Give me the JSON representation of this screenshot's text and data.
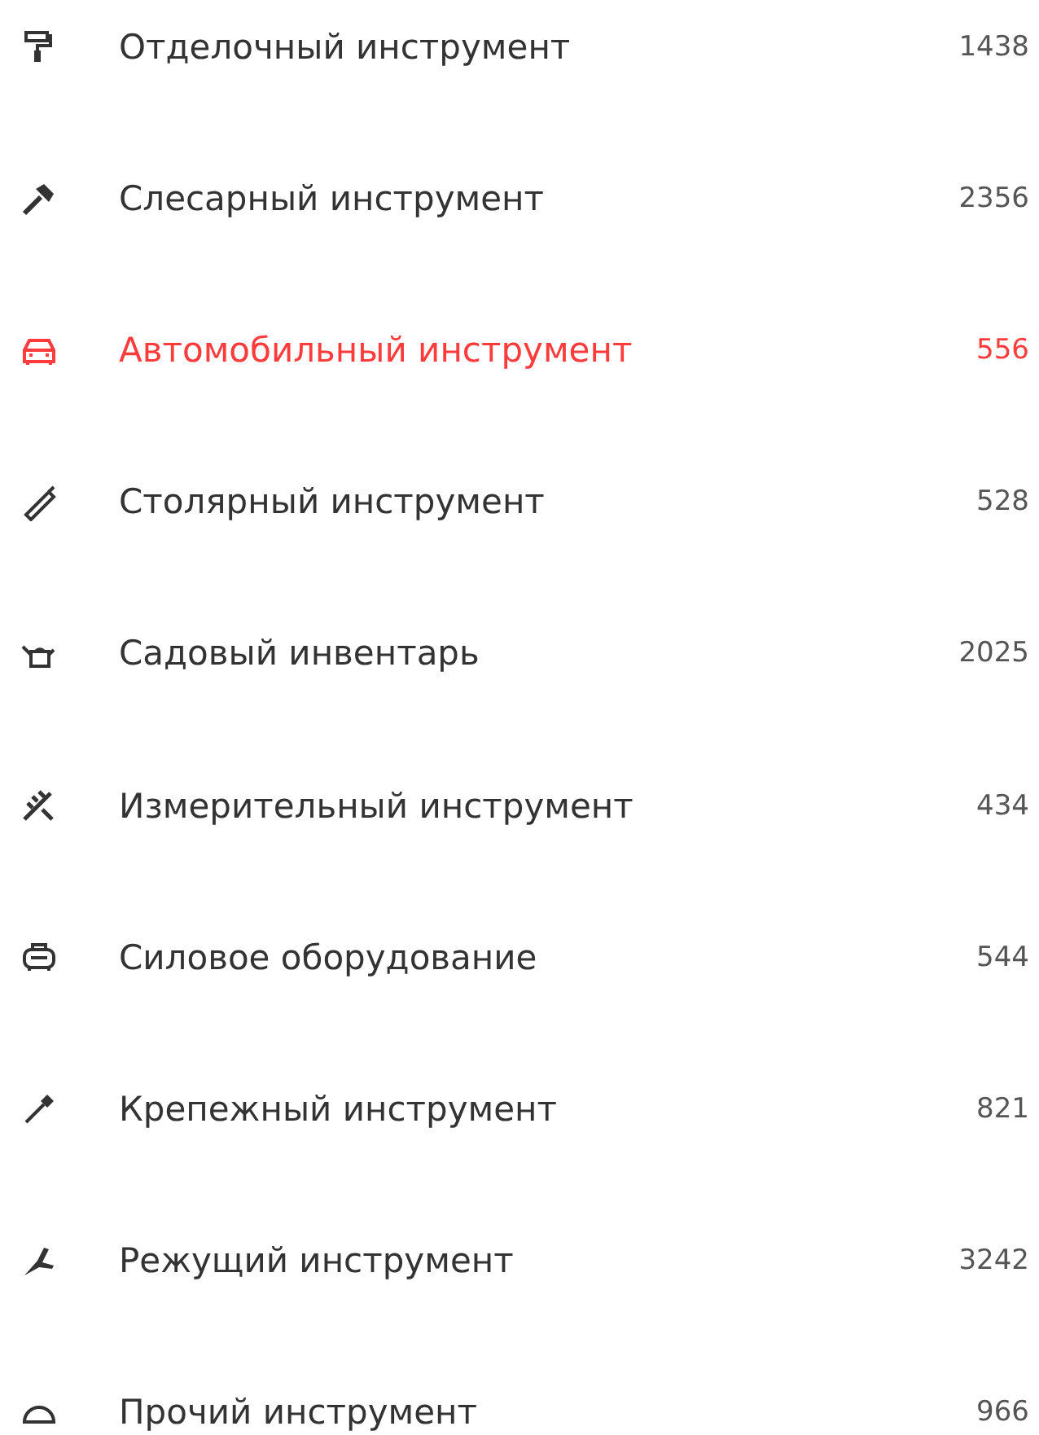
{
  "categories": [
    {
      "label": "Отделочный инструмент",
      "count": "1438",
      "selected": false
    },
    {
      "label": "Слесарный инструмент",
      "count": "2356",
      "selected": false
    },
    {
      "label": "Автомобильный инструмент",
      "count": "556",
      "selected": true
    },
    {
      "label": "Столярный инструмент",
      "count": "528",
      "selected": false
    },
    {
      "label": "Садовый инвентарь",
      "count": "2025",
      "selected": false
    },
    {
      "label": "Измерительный инструмент",
      "count": "434",
      "selected": false
    },
    {
      "label": "Силовое оборудование",
      "count": "544",
      "selected": false
    },
    {
      "label": "Крепежный инструмент",
      "count": "821",
      "selected": false
    },
    {
      "label": "Режущий инструмент",
      "count": "3242",
      "selected": false
    },
    {
      "label": "Прочий инструмент",
      "count": "966",
      "selected": false
    }
  ]
}
